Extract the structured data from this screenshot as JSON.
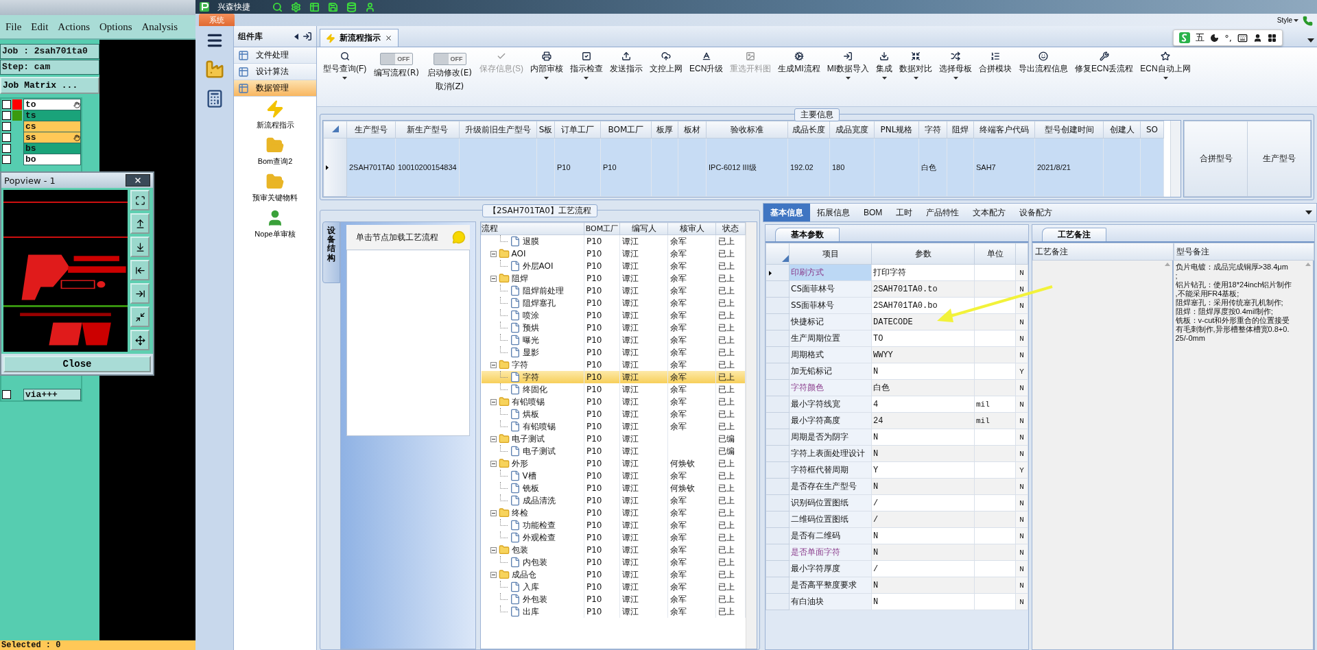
{
  "cam": {
    "menu": [
      "File",
      "Edit",
      "Actions",
      "Options",
      "Analysis"
    ],
    "job": "Job : 2sah701ta0",
    "step": "Step: cam",
    "matrix_button": "Job Matrix ...",
    "layers": [
      {
        "name": "to",
        "checked": false,
        "color": "#ffffff",
        "swatch": {
          "color": "#ff0000"
        },
        "marked": true
      },
      {
        "name": "ts",
        "checked": false,
        "color": "#1aa37a",
        "swatch": {
          "color": "#3a9a10"
        },
        "marked": false
      },
      {
        "name": "cs",
        "checked": false,
        "color": "#ffc857",
        "marked": false
      },
      {
        "name": "ss",
        "checked": false,
        "color": "#ffc857",
        "marked": true
      },
      {
        "name": "bs",
        "checked": false,
        "color": "#1aa37a",
        "marked": false
      },
      {
        "name": "bo",
        "checked": false,
        "color": "#ffffff",
        "marked": false
      }
    ],
    "layers_lower": [
      {
        "name": "via+++",
        "checked": false,
        "color": "#b6e3dd",
        "marked": false
      }
    ],
    "popup": {
      "title": "Popview - 1",
      "button": "Close"
    },
    "status": "Selected : 0"
  },
  "app": {
    "title": "兴森快捷",
    "menu_tab": "系统",
    "style_menu": "Style"
  },
  "components": {
    "title": "组件库",
    "categories": [
      {
        "label": "文件处理",
        "selected": false
      },
      {
        "label": "设计算法",
        "selected": false
      },
      {
        "label": "数据管理",
        "selected": true
      }
    ],
    "tools": [
      {
        "label": "新流程指示"
      },
      {
        "label": "Bom查询2"
      },
      {
        "label": "预审关键物料"
      },
      {
        "label": "Nope单审核"
      }
    ]
  },
  "document_tab": {
    "label": "新流程指示"
  },
  "ime": {
    "mode": "五",
    "punct": "°,"
  },
  "toolbar": [
    {
      "kind": "button",
      "label": "型号查询(F)",
      "dropdown": true,
      "disabled": false
    },
    {
      "kind": "toggle",
      "label": "编写流程(R)",
      "state_text": "OFF",
      "on": false
    },
    {
      "kind": "toggle",
      "label": "启动修改(E)",
      "sublabel": "取消(Z)",
      "state_text": "OFF",
      "on": false
    },
    {
      "kind": "button",
      "label": "保存信息(S)",
      "dropdown": false,
      "disabled": true
    },
    {
      "kind": "button",
      "label": "内部审核",
      "dropdown": true,
      "disabled": false
    },
    {
      "kind": "button",
      "label": "指示检查",
      "dropdown": true,
      "disabled": false
    },
    {
      "kind": "button",
      "label": "发送指示",
      "dropdown": false,
      "disabled": false
    },
    {
      "kind": "button",
      "label": "文控上网",
      "dropdown": false,
      "disabled": false
    },
    {
      "kind": "button",
      "label": "ECN升级",
      "dropdown": false,
      "disabled": false
    },
    {
      "kind": "button",
      "label": "重选开料图",
      "dropdown": false,
      "disabled": true
    },
    {
      "kind": "button",
      "label": "生成MI流程",
      "dropdown": false,
      "disabled": false
    },
    {
      "kind": "button",
      "label": "MI数据导入",
      "dropdown": true,
      "disabled": false
    },
    {
      "kind": "button",
      "label": "集成",
      "dropdown": true,
      "disabled": false
    },
    {
      "kind": "button",
      "label": "数据对比",
      "dropdown": true,
      "disabled": false
    },
    {
      "kind": "button",
      "label": "选择母板",
      "dropdown": true,
      "disabled": false
    },
    {
      "kind": "button",
      "label": "合拼模块",
      "dropdown": false,
      "disabled": false
    },
    {
      "kind": "button",
      "label": "导出流程信息",
      "dropdown": false,
      "disabled": false
    },
    {
      "kind": "button",
      "label": "修复ECN丢流程",
      "dropdown": false,
      "disabled": false
    },
    {
      "kind": "button",
      "label": "ECN自动上网",
      "dropdown": true,
      "disabled": false
    }
  ],
  "main_info": {
    "title": "主要信息",
    "columns": [
      "生产型号",
      "新生产型号",
      "升级前旧生产型号",
      "S板",
      "订单工厂",
      "BOM工厂",
      "板厚",
      "板材",
      "验收标准",
      "成品长度",
      "成品宽度",
      "PNL规格",
      "字符",
      "阻焊",
      "终端客户代码",
      "型号创建时间",
      "创建人",
      "SO"
    ],
    "rows": [
      {
        "selected": true,
        "cells": [
          "2SAH701TA0",
          "10010200154834",
          null,
          null,
          "P10",
          "P10",
          null,
          null,
          "IPC-6012 III级",
          "192.02",
          "180",
          null,
          "白色",
          null,
          "SAH7",
          "2021/8/21",
          null,
          null
        ]
      }
    ],
    "side_columns": [
      "合拼型号",
      "生产型号"
    ]
  },
  "process": {
    "title": "【2SAH701TA0】工艺流程",
    "side_tab": {
      "label": "设备结构",
      "selected": true
    },
    "hint": "单击节点加载工艺流程",
    "columns": [
      "流程",
      "BOM工厂",
      "编写人",
      "核审人",
      "状态"
    ],
    "nodes": [
      {
        "children": [
          {
            "label": "退膜",
            "kind": "file",
            "bom": "P10",
            "writer": "谭江",
            "reviewer": "余军",
            "status": "已上",
            "selected": false
          }
        ]
      },
      {
        "label": "AOI",
        "kind": "folder",
        "expanded": true,
        "bom": "P10",
        "writer": "谭江",
        "reviewer": "余军",
        "status": "已上",
        "selected": false,
        "children": [
          {
            "label": "外层AOI",
            "kind": "file",
            "bom": "P10",
            "writer": "谭江",
            "reviewer": "余军",
            "status": "已上",
            "selected": false
          }
        ]
      },
      {
        "label": "阻焊",
        "kind": "folder",
        "expanded": true,
        "bom": "P10",
        "writer": "谭江",
        "reviewer": "余军",
        "status": "已上",
        "selected": false,
        "children": [
          {
            "label": "阻焊前处理",
            "kind": "file",
            "bom": "P10",
            "writer": "谭江",
            "reviewer": "余军",
            "status": "已上",
            "selected": false
          },
          {
            "label": "阻焊塞孔",
            "kind": "file",
            "bom": "P10",
            "writer": "谭江",
            "reviewer": "余军",
            "status": "已上",
            "selected": false
          },
          {
            "label": "喷涂",
            "kind": "file",
            "bom": "P10",
            "writer": "谭江",
            "reviewer": "余军",
            "status": "已上",
            "selected": false
          },
          {
            "label": "预烘",
            "kind": "file",
            "bom": "P10",
            "writer": "谭江",
            "reviewer": "余军",
            "status": "已上",
            "selected": false
          },
          {
            "label": "曝光",
            "kind": "file",
            "bom": "P10",
            "writer": "谭江",
            "reviewer": "余军",
            "status": "已上",
            "selected": false
          },
          {
            "label": "显影",
            "kind": "file",
            "bom": "P10",
            "writer": "谭江",
            "reviewer": "余军",
            "status": "已上",
            "selected": false
          }
        ]
      },
      {
        "label": "字符",
        "kind": "folder",
        "expanded": true,
        "bom": "P10",
        "writer": "谭江",
        "reviewer": "余军",
        "status": "已上",
        "selected": false,
        "children": [
          {
            "label": "字符",
            "kind": "file",
            "bom": "P10",
            "writer": "谭江",
            "reviewer": "余军",
            "status": "已上",
            "selected": true
          },
          {
            "label": "终固化",
            "kind": "file",
            "bom": "P10",
            "writer": "谭江",
            "reviewer": "余军",
            "status": "已上",
            "selected": false
          }
        ]
      },
      {
        "label": "有铅喷锡",
        "kind": "folder",
        "expanded": true,
        "bom": "P10",
        "writer": "谭江",
        "reviewer": "余军",
        "status": "已上",
        "selected": false,
        "children": [
          {
            "label": "烘板",
            "kind": "file",
            "bom": "P10",
            "writer": "谭江",
            "reviewer": "余军",
            "status": "已上",
            "selected": false
          },
          {
            "label": "有铅喷锡",
            "kind": "file",
            "bom": "P10",
            "writer": "谭江",
            "reviewer": "余军",
            "status": "已上",
            "selected": false
          }
        ]
      },
      {
        "label": "电子测试",
        "kind": "folder",
        "expanded": true,
        "bom": "P10",
        "writer": "谭江",
        "status": "已编",
        "selected": false,
        "children": [
          {
            "label": "电子测试",
            "kind": "file",
            "bom": "P10",
            "writer": "谭江",
            "status": "已编",
            "selected": false
          }
        ]
      },
      {
        "label": "外形",
        "kind": "folder",
        "expanded": true,
        "bom": "P10",
        "writer": "谭江",
        "reviewer": "何焕钦",
        "status": "已上",
        "selected": false,
        "children": [
          {
            "label": "V槽",
            "kind": "file",
            "bom": "P10",
            "writer": "谭江",
            "reviewer": "余军",
            "status": "已上",
            "selected": false
          },
          {
            "label": "铣板",
            "kind": "file",
            "bom": "P10",
            "writer": "谭江",
            "reviewer": "何焕钦",
            "status": "已上",
            "selected": false
          },
          {
            "label": "成品清洗",
            "kind": "file",
            "bom": "P10",
            "writer": "谭江",
            "reviewer": "余军",
            "status": "已上",
            "selected": false
          }
        ]
      },
      {
        "label": "终检",
        "kind": "folder",
        "expanded": true,
        "bom": "P10",
        "writer": "谭江",
        "reviewer": "余军",
        "status": "已上",
        "selected": false,
        "children": [
          {
            "label": "功能检查",
            "kind": "file",
            "bom": "P10",
            "writer": "谭江",
            "reviewer": "余军",
            "status": "已上",
            "selected": false
          },
          {
            "label": "外观检查",
            "kind": "file",
            "bom": "P10",
            "writer": "谭江",
            "reviewer": "余军",
            "status": "已上",
            "selected": false
          }
        ]
      },
      {
        "label": "包装",
        "kind": "folder",
        "expanded": true,
        "bom": "P10",
        "writer": "谭江",
        "reviewer": "余军",
        "status": "已上",
        "selected": false,
        "children": [
          {
            "label": "内包装",
            "kind": "file",
            "bom": "P10",
            "writer": "谭江",
            "reviewer": "余军",
            "status": "已上",
            "selected": false
          }
        ]
      },
      {
        "label": "成品仓",
        "kind": "folder",
        "expanded": true,
        "bom": "P10",
        "writer": "谭江",
        "reviewer": "余军",
        "status": "已上",
        "selected": false,
        "children": [
          {
            "label": "入库",
            "kind": "file",
            "bom": "P10",
            "writer": "谭江",
            "reviewer": "余军",
            "status": "已上",
            "selected": false
          },
          {
            "label": "外包装",
            "kind": "file",
            "bom": "P10",
            "writer": "谭江",
            "reviewer": "余军",
            "status": "已上",
            "selected": false
          },
          {
            "label": "出库",
            "kind": "file",
            "bom": "P10",
            "writer": "谭江",
            "reviewer": "余军",
            "status": "已上",
            "selected": false
          }
        ]
      }
    ]
  },
  "detail_tabs": [
    {
      "label": "基本信息",
      "selected": true
    },
    {
      "label": "拓展信息",
      "selected": false
    },
    {
      "label": "BOM",
      "selected": false
    },
    {
      "label": "工时",
      "selected": false
    },
    {
      "label": "产品特性",
      "selected": false
    },
    {
      "label": "文本配方",
      "selected": false
    },
    {
      "label": "设备配方",
      "selected": false
    }
  ],
  "params": {
    "tab": "基本参数",
    "columns": [
      "项目",
      "参数",
      "单位"
    ],
    "rows": [
      {
        "item": "印刷方式",
        "value": "打印字符",
        "flag": "N",
        "flagged": true,
        "selected": true
      },
      {
        "item": "CS面菲林号",
        "value": "2SAH701TA0.to",
        "flag": "N",
        "flagged": false,
        "selected": false
      },
      {
        "item": "SS面菲林号",
        "value": "2SAH701TA0.bo",
        "flag": "N",
        "flagged": false,
        "selected": false
      },
      {
        "item": "快捷标记",
        "value": "DATECODE",
        "flag": "N",
        "flagged": false,
        "selected": false
      },
      {
        "item": "生产周期位置",
        "value": "TO",
        "flag": "N",
        "flagged": false,
        "selected": false
      },
      {
        "item": "周期格式",
        "value": "WWYY",
        "flag": "N",
        "flagged": false,
        "selected": false
      },
      {
        "item": "加无铅标记",
        "value": "N",
        "flag": "Y",
        "flagged": false,
        "selected": false
      },
      {
        "item": "字符颜色",
        "value": "白色",
        "flag": "N",
        "flagged": true,
        "selected": false
      },
      {
        "item": "最小字符线宽",
        "value": "4",
        "unit": "mil",
        "flag": "N",
        "flagged": false,
        "selected": false
      },
      {
        "item": "最小字符高度",
        "value": "24",
        "unit": "mil",
        "flag": "N",
        "flagged": false,
        "selected": false
      },
      {
        "item": "周期是否为阴字",
        "value": "N",
        "flag": "N",
        "flagged": false,
        "selected": false
      },
      {
        "item": "字符上表面处理设计",
        "value": "N",
        "flag": "N",
        "flagged": false,
        "selected": false
      },
      {
        "item": "字符框代替周期",
        "value": "Y",
        "flag": "Y",
        "flagged": false,
        "selected": false
      },
      {
        "item": "是否存在生产型号",
        "value": "N",
        "flag": "N",
        "flagged": false,
        "selected": false
      },
      {
        "item": "识别码位置图纸",
        "value": "/",
        "flag": "N",
        "flagged": false,
        "selected": false
      },
      {
        "item": "二维码位置图纸",
        "value": "/",
        "flag": "N",
        "flagged": false,
        "selected": false
      },
      {
        "item": "是否有二维码",
        "value": "N",
        "flag": "N",
        "flagged": false,
        "selected": false
      },
      {
        "item": "是否单面字符",
        "value": "N",
        "flag": "N",
        "flagged": true,
        "selected": false
      },
      {
        "item": "最小字符厚度",
        "value": "/",
        "flag": "N",
        "flagged": false,
        "selected": false
      },
      {
        "item": "是否高平整度要求",
        "value": "N",
        "flag": "N",
        "flagged": false,
        "selected": false
      },
      {
        "item": "有白油块",
        "value": "N",
        "flag": "N",
        "flagged": false,
        "selected": false
      }
    ]
  },
  "notes": {
    "tab": "工艺备注",
    "columns": [
      "工艺备注",
      "型号备注"
    ],
    "model_note": "负片电镀：成品完成铜厚>38.4μm\n;\n铝片钻孔：使用18*24inch铝片制作\n,不能采用FR4基板;\n阻焊塞孔：采用传统塞孔机制作;\n阻焊：阻焊厚度按0.4mil制作;\n铣板：v-cut和外形重合的位置接受有毛刺制作,异形槽整体槽宽0.8+0.25/-0mm"
  }
}
